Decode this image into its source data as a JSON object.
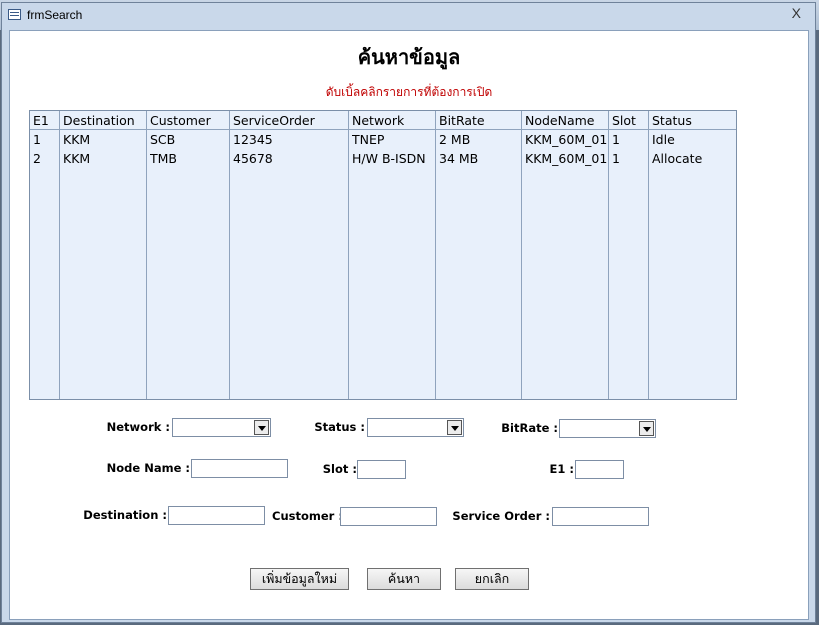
{
  "window": {
    "title": "frmSearch",
    "close_label": "X"
  },
  "form": {
    "heading": "ค้นหาข้อมูล",
    "subheading": "ดับเบิ้ลคลิกรายการที่ต้องการเปิด"
  },
  "list": {
    "columns": [
      "E1",
      "Destination",
      "Customer",
      "ServiceOrder",
      "Network",
      "BitRate",
      "NodeName",
      "Slot",
      "Status"
    ],
    "rows": [
      [
        "1",
        "KKM",
        "SCB",
        "12345",
        "TNEP",
        "2 MB",
        "KKM_60M_01",
        "1",
        "Idle"
      ],
      [
        "2",
        "KKM",
        "TMB",
        "45678",
        "H/W B-ISDN",
        "34 MB",
        "KKM_60M_01",
        "1",
        "Allocate"
      ]
    ]
  },
  "filters": {
    "network_label": "Network :",
    "status_label": "Status :",
    "bitrate_label": "BitRate :",
    "nodename_label": "Node Name :",
    "slot_label": "Slot :",
    "e1_label": "E1 :",
    "destination_label": "Destination :",
    "customer_label": "Customer :",
    "serviceorder_label": "Service Order :",
    "network_value": "",
    "status_value": "",
    "bitrate_value": "",
    "nodename_value": "",
    "slot_value": "",
    "e1_value": "",
    "destination_value": "",
    "customer_value": "",
    "serviceorder_value": ""
  },
  "buttons": {
    "add_new": "เพิ่มข้อมูลใหม่",
    "search": "ค้นหา",
    "cancel": "ยกเลิก"
  },
  "colors": {
    "list_background": "#e8f0fb",
    "subheading": "#c00000",
    "frame": "#c9d8ea"
  }
}
